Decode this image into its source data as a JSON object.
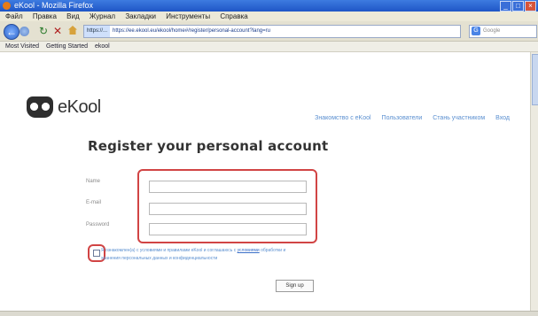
{
  "window": {
    "title": "eKool - Mozilla Firefox"
  },
  "menu": [
    "Файл",
    "Правка",
    "Вид",
    "Журнал",
    "Закладки",
    "Инструменты",
    "Справка"
  ],
  "nav": {
    "url_site": "https://...",
    "url_text": "https://ee.ekool.eu/ekool/home#/register/personal-account?lang=ru",
    "search_placeholder": "Google"
  },
  "bookmarks": [
    "Most Visited",
    "Getting Started",
    "ekool"
  ],
  "site": {
    "logo_text": "eKool",
    "links": [
      "Знакомство с eKool",
      "Пользователи",
      "Стань участником",
      "Вход"
    ]
  },
  "form": {
    "heading": "Register your personal account",
    "labels": [
      "Name",
      "E-mail",
      "Password"
    ],
    "terms_prefix": "Я ознакомлен(а) с условиями и правилами eKool и соглашаюсь с ",
    "terms_link": "условиями",
    "terms_rest": " обработки и хранения персональных данных и конфиденциальности",
    "signup_label": "Sign up"
  },
  "colors": {
    "highlight": "#d14444",
    "link": "#5a8fd0",
    "titlebar": "#2a62d0"
  }
}
